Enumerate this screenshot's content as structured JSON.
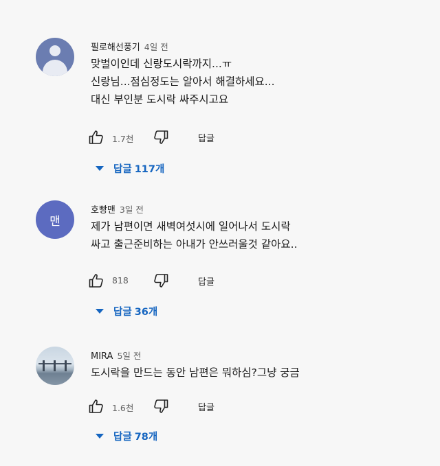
{
  "comments": [
    {
      "author": "필로해선풍기",
      "time": "4일 전",
      "avatar": "default-user-icon",
      "lines": [
        "맞벌이인데 신랑도시락까지...ㅠ",
        "신랑님...점심정도는 알아서 해결하세요...",
        "대신 부인분 도시락 싸주시고요"
      ],
      "likes": "1.7천",
      "reply_label": "답글",
      "replies_label": "답글",
      "replies_count": "117개"
    },
    {
      "author": "호빵맨",
      "time": "3일 전",
      "avatar_letter": "맨",
      "lines": [
        "제가 남편이면 새벽여섯시에 일어나서 도시락",
        "싸고 출근준비하는 아내가 안쓰러울것 같아요.."
      ],
      "likes": "818",
      "reply_label": "답글",
      "replies_label": "답글",
      "replies_count": "36개"
    },
    {
      "author": "MIRA",
      "time": "5일 전",
      "avatar": "photo-avatar",
      "lines": [
        "도시락을 만드는 동안 남편은 뭐하심?그냥 궁금"
      ],
      "likes": "1.6천",
      "reply_label": "답글",
      "replies_label": "답글",
      "replies_count": "78개"
    }
  ],
  "colors": {
    "link_blue": "#1565c0",
    "background": "#f7f7f7",
    "avatar_letter_bg": "#5c6bc0"
  }
}
